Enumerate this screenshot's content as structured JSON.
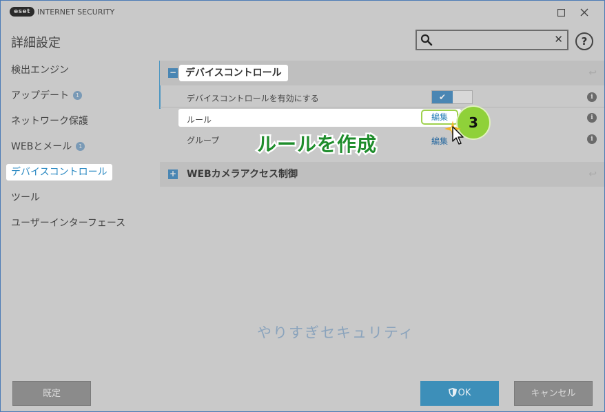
{
  "app": {
    "logo": "eset",
    "title": "INTERNET SECURITY"
  },
  "window": {
    "maximize_icon": "maximize-icon",
    "close_icon": "close-icon"
  },
  "header": {
    "title": "詳細設定",
    "search_placeholder": "",
    "search_value": "",
    "help": "?"
  },
  "sidebar": {
    "items": [
      {
        "label": "検出エンジン"
      },
      {
        "label": "アップデート",
        "badge": "1"
      },
      {
        "label": "ネットワーク保護"
      },
      {
        "label": "WEBとメール",
        "badge": "1"
      },
      {
        "label": "デバイスコントロール",
        "active": true
      },
      {
        "label": "ツール"
      },
      {
        "label": "ユーザーインターフェース"
      }
    ]
  },
  "main": {
    "section1": {
      "toggle_symbol": "−",
      "title": "デバイスコントロール",
      "rows": [
        {
          "label": "デバイスコントロールを有効にする",
          "toggle": true
        },
        {
          "label": "ルール",
          "action": "編集"
        },
        {
          "label": "グループ",
          "action": "編集"
        }
      ]
    },
    "section2": {
      "toggle_symbol": "+",
      "title": "WEBカメラアクセス制御"
    }
  },
  "annotation": {
    "step": "3",
    "callout": "ルールを作成",
    "accent": "#8fd139",
    "callout_color": "#1f8d2c"
  },
  "watermark": "やりすぎセキュリティ",
  "footer": {
    "default": "既定",
    "ok": "OK",
    "cancel": "キャンセル"
  },
  "colors": {
    "accent": "#2a89c2",
    "toggle_on": "#4a86b3"
  }
}
